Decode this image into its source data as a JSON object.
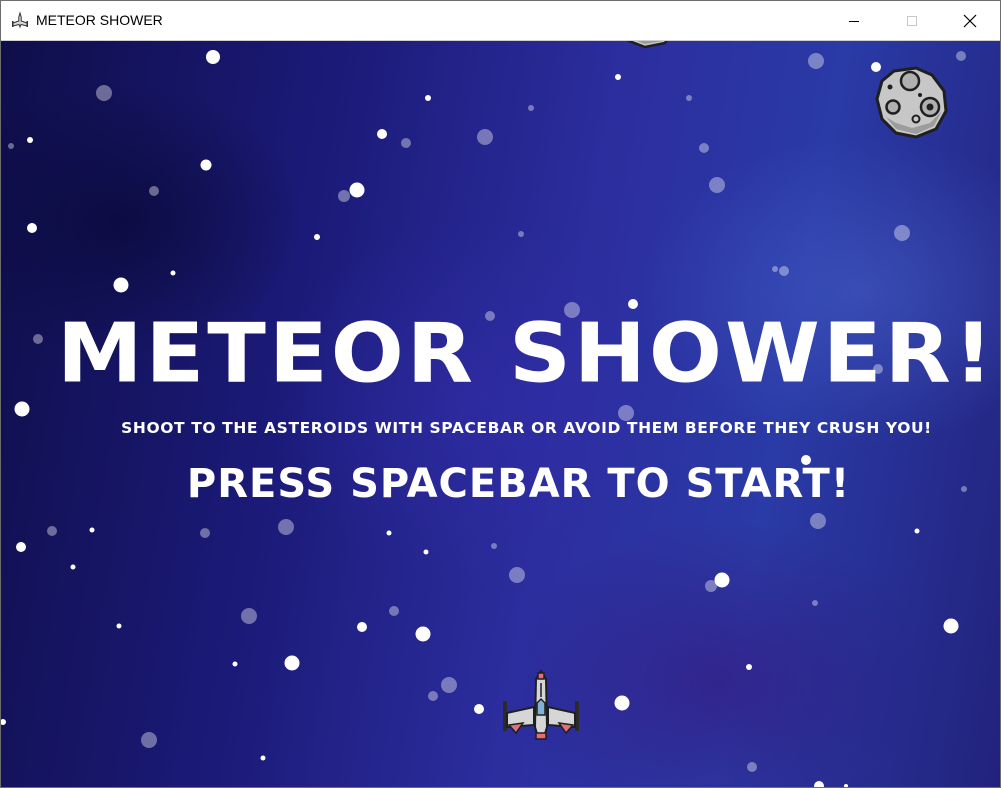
{
  "window": {
    "title": "METEOR SHOWER",
    "app_icon": "spaceship-icon",
    "controls": {
      "minimize": "minimize-icon",
      "maximize": "maximize-icon",
      "close": "close-icon"
    }
  },
  "game": {
    "title": "METEOR SHOWER!",
    "instructions": "SHOOT TO THE ASTEROIDS WITH SPACEBAR OR AVOID THEM BEFORE THEY CRUSH YOU!",
    "start_prompt": "PRESS SPACEBAR TO START!",
    "player_sprite": "spaceship-icon",
    "enemy_sprite": "asteroid-icon",
    "background_color": "#1b1a78",
    "text_color": "#ffffff"
  }
}
